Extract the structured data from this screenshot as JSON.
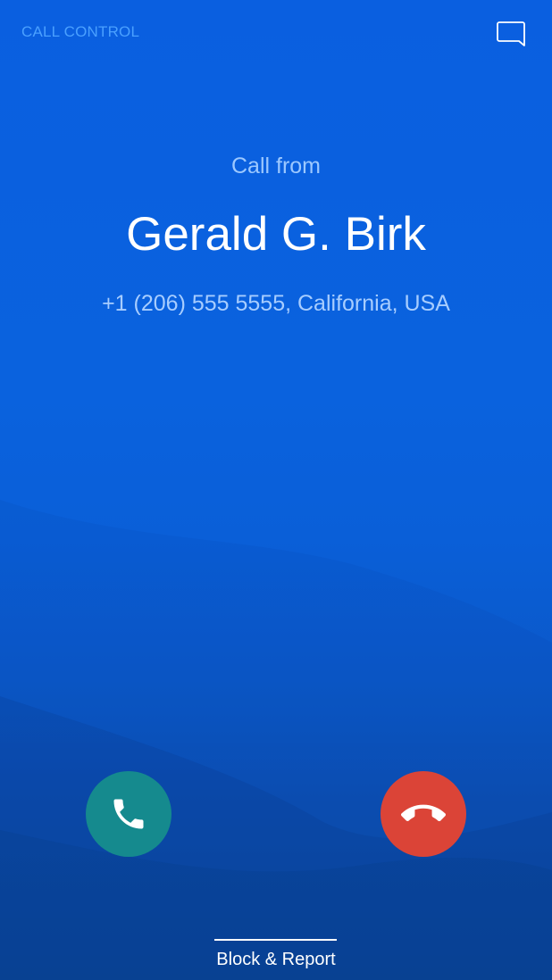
{
  "header": {
    "label": "CALL CONTROL",
    "message_icon": "message-bubble-icon"
  },
  "call": {
    "heading": "Call from",
    "caller_name": "Gerald G. Birk",
    "caller_info": "+1 (206) 555 5555, California, USA"
  },
  "actions": {
    "accept_icon": "phone-icon",
    "decline_icon": "hang-up-icon",
    "block_report_label": "Block & Report"
  },
  "colors": {
    "background": "#0a5fe0",
    "accent_label": "#4aa0ff",
    "accept": "#158a8e",
    "decline": "#db4437"
  }
}
